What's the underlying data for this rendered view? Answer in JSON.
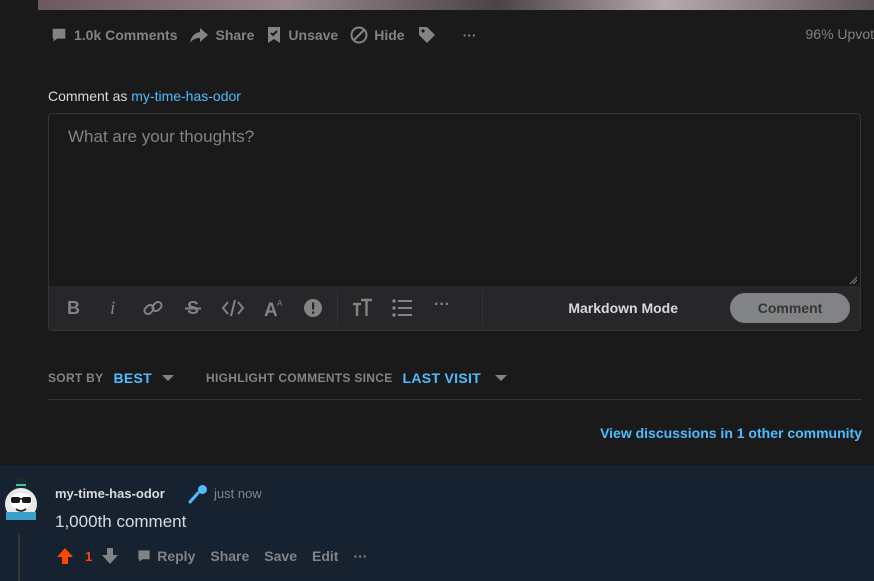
{
  "post_actions": {
    "comments_label": "1.0k Comments",
    "share_label": "Share",
    "unsave_label": "Unsave",
    "hide_label": "Hide",
    "more_label": "···",
    "upvote_ratio": "96% Upvot"
  },
  "comment_form": {
    "prefix": "Comment as",
    "username": "my-time-has-odor",
    "placeholder": "What are your thoughts?",
    "toolbar_more": "···",
    "markdown_mode_label": "Markdown Mode",
    "submit_label": "Comment"
  },
  "sort": {
    "sort_by_label": "SORT BY",
    "sort_value": "BEST",
    "highlight_label": "HIGHLIGHT COMMENTS SINCE",
    "highlight_value": "LAST VISIT"
  },
  "view_discussions": "View discussions in 1 other community",
  "comment": {
    "author": "my-time-has-odor",
    "time": "just now",
    "body": "1,000th comment",
    "score": "1",
    "reply_label": "Reply",
    "share_label": "Share",
    "save_label": "Save",
    "edit_label": "Edit",
    "more_label": "···"
  },
  "colors": {
    "background": "#1a1a1b",
    "accent_link": "#4fbcff",
    "upvote_active": "#ff4500",
    "comment_highlight_bg": "#172231"
  }
}
